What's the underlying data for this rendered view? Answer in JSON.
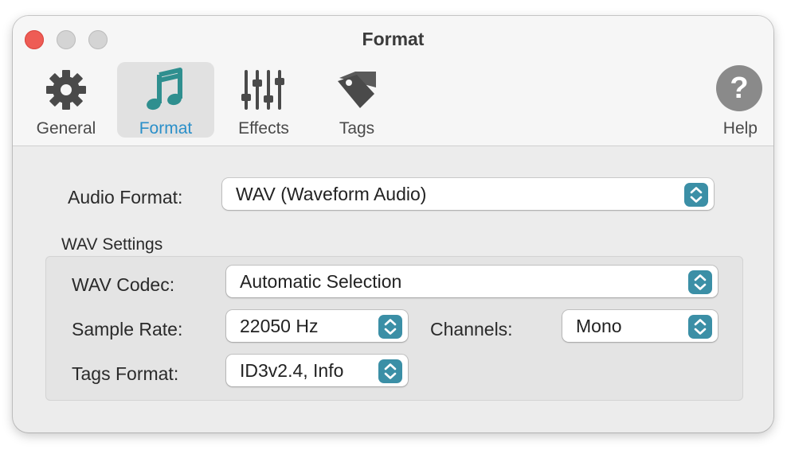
{
  "window": {
    "title": "Format"
  },
  "toolbar": {
    "tabs": [
      {
        "label": "General",
        "icon": "gear-icon"
      },
      {
        "label": "Format",
        "icon": "music-note-icon",
        "active": true
      },
      {
        "label": "Effects",
        "icon": "sliders-icon"
      },
      {
        "label": "Tags",
        "icon": "tag-icon"
      }
    ],
    "help": {
      "label": "Help",
      "glyph": "?"
    }
  },
  "audio_format": {
    "label": "Audio Format:",
    "value": "WAV (Waveform Audio)"
  },
  "wav_settings": {
    "heading": "WAV Settings",
    "codec": {
      "label": "WAV Codec:",
      "value": "Automatic Selection"
    },
    "sample_rate": {
      "label": "Sample Rate:",
      "value": "22050 Hz"
    },
    "channels": {
      "label": "Channels:",
      "value": "Mono"
    },
    "tags_format": {
      "label": "Tags Format:",
      "value": "ID3v2.4, Info"
    }
  },
  "colors": {
    "accent": "#2a8fc9",
    "stepper": "#3b8fa6",
    "close_button": "#ee5c55",
    "music_icon": "#2f8f8f"
  }
}
